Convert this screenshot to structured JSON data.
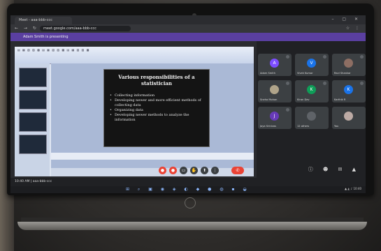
{
  "browser": {
    "tab_title": "Meet - aaa-bbb-ccc",
    "url": "meet.google.com/aaa-bbb-ccc",
    "presenting_label": "Adam Smith is presenting"
  },
  "slide": {
    "title": "Various responsibilities of a statistician",
    "bullets": [
      "Collecting information",
      "Developing newer and more efficient methods of collecting data",
      "Organizing data",
      "Developing newer methods to analyze the information"
    ]
  },
  "participants": [
    {
      "name": "Adam Smith",
      "initial": "A",
      "color": "#7c4dff"
    },
    {
      "name": "Vivek Kumar",
      "initial": "V",
      "color": "#1a73e8"
    },
    {
      "name": "Ravi Shankar",
      "initial": "",
      "color": "#8d6e63"
    },
    {
      "name": "Sneha Mohan",
      "initial": "",
      "color": "#b0a48a"
    },
    {
      "name": "Kiran Dev",
      "initial": "K",
      "color": "#0f9d58"
    },
    {
      "name": "Karthik R",
      "initial": "K",
      "color": "#1a73e8"
    },
    {
      "name": "Jaya Srinivas",
      "initial": "J",
      "color": "#673ab7"
    },
    {
      "name": "12 others",
      "initial": "",
      "color": "#3c4043"
    },
    {
      "name": "You",
      "initial": "",
      "color": "#bcaaa4"
    }
  ],
  "meeting": {
    "time_code": "10:40 AM | aaa-bbb-ccc"
  },
  "icons": {
    "controls": [
      "mic-icon",
      "camera-icon",
      "captions-icon",
      "raise-hand-icon",
      "present-icon",
      "more-icon",
      "end-call-icon"
    ],
    "right": [
      "info-icon",
      "people-icon",
      "chat-icon",
      "activities-icon"
    ]
  }
}
